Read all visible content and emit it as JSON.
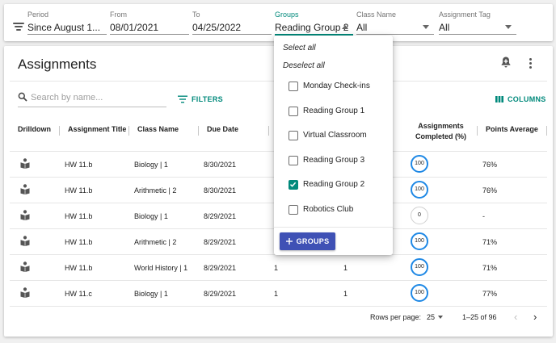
{
  "filters": {
    "period": {
      "label": "Period",
      "value": "Since August 1..."
    },
    "from": {
      "label": "From",
      "value": "08/01/2021"
    },
    "to": {
      "label": "To",
      "value": "04/25/2022"
    },
    "groups": {
      "label": "Groups",
      "value": "Reading Group 2"
    },
    "class_name": {
      "label": "Class Name",
      "value": "All"
    },
    "assignment_tag": {
      "label": "Assignment Tag",
      "value": "All"
    }
  },
  "card": {
    "title": "Assignments",
    "search_placeholder": "Search by name...",
    "filters_label": "FILTERS",
    "columns_label": "COLUMNS"
  },
  "table": {
    "headers": {
      "drilldown": "Drilldown",
      "title": "Assignment Title",
      "class_name": "Class Name",
      "due_date": "Due Date",
      "completed_line1": "Assignments",
      "completed_line2": "Completed (%)",
      "points": "Points Average"
    },
    "rows": [
      {
        "title": "HW 11.b",
        "class_name": "Biology | 1",
        "due": "8/30/2021",
        "c1": "1",
        "c2": "1",
        "completed": "100",
        "points": "76%"
      },
      {
        "title": "HW 11.b",
        "class_name": "Arithmetic | 2",
        "due": "8/30/2021",
        "c1": "1",
        "c2": "1",
        "completed": "100",
        "points": "76%"
      },
      {
        "title": "HW 11.b",
        "class_name": "Biology | 1",
        "due": "8/29/2021",
        "c1": "1",
        "c2": "",
        "completed": "0",
        "points": "-"
      },
      {
        "title": "HW 11.b",
        "class_name": "Arithmetic | 2",
        "due": "8/29/2021",
        "c1": "1",
        "c2": "1",
        "completed": "100",
        "points": "71%"
      },
      {
        "title": "HW 11.b",
        "class_name": "World History | 1",
        "due": "8/29/2021",
        "c1": "1",
        "c2": "1",
        "completed": "100",
        "points": "71%"
      },
      {
        "title": "HW 11.c",
        "class_name": "Biology | 1",
        "due": "8/29/2021",
        "c1": "1",
        "c2": "1",
        "completed": "100",
        "points": "77%"
      }
    ]
  },
  "pagination": {
    "rows_per_page_label": "Rows per page:",
    "rows_per_page": "25",
    "range": "1–25 of 96"
  },
  "groups_menu": {
    "select_all": "Select all",
    "deselect_all": "Deselect all",
    "options": [
      {
        "label": "Monday Check-ins",
        "checked": false
      },
      {
        "label": "Reading Group 1",
        "checked": false
      },
      {
        "label": "Virtual Classroom",
        "checked": false
      },
      {
        "label": "Reading Group 3",
        "checked": false
      },
      {
        "label": "Reading Group 2",
        "checked": true
      },
      {
        "label": "Robotics Club",
        "checked": false
      }
    ],
    "add_button": "GROUPS"
  },
  "colors": {
    "accent": "#00897b",
    "primary": "#3f51b5",
    "progress": "#1e88e5"
  }
}
